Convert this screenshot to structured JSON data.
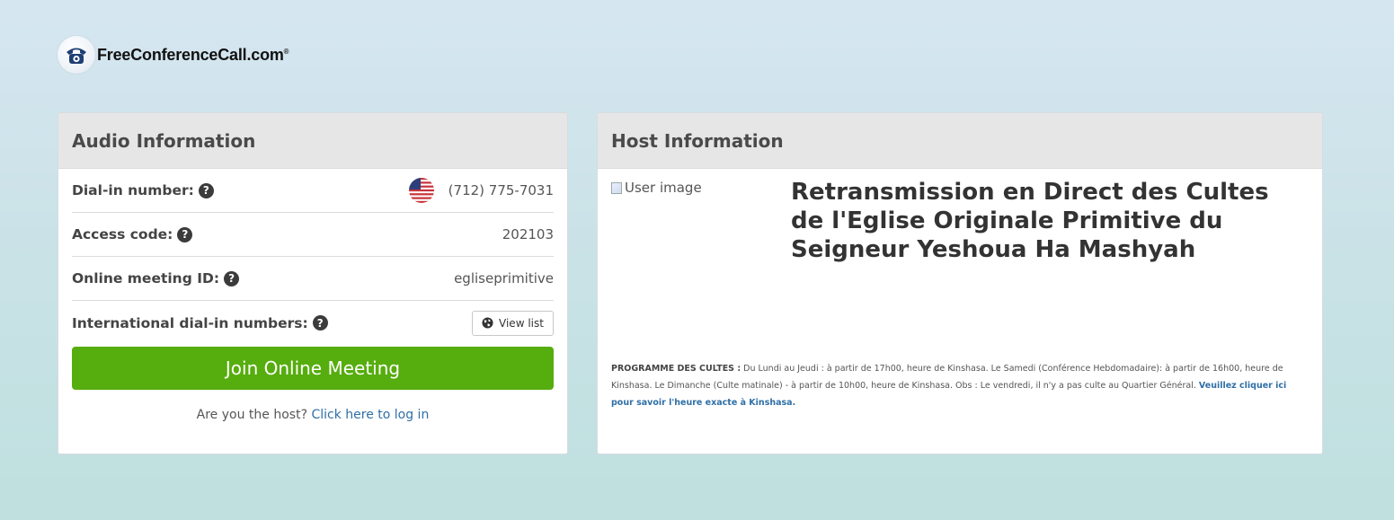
{
  "brand": {
    "name": "FreeConferenceCall.com",
    "reg_mark": "®"
  },
  "audio": {
    "title": "Audio Information",
    "dial_in_label": "Dial-in number:",
    "dial_in_value": "(712) 775-7031",
    "access_code_label": "Access code:",
    "access_code_value": "202103",
    "meeting_id_label": "Online meeting ID:",
    "meeting_id_value": "egliseprimitive",
    "intl_label": "International dial-in numbers:",
    "view_list_label": "View list",
    "join_label": "Join Online Meeting",
    "host_prompt": "Are you the host?",
    "host_login_label": "Click here to log in"
  },
  "host": {
    "title": "Host Information",
    "user_image_alt": "User image",
    "meeting_title": "Retransmission en Direct des Cultes de l'Eglise Originale Primitive du Seigneur Yeshoua Ha Mashyah",
    "programme_label": "PROGRAMME DES CULTES :",
    "programme_text": "Du Lundi au Jeudi : à partir de 17h00, heure de Kinshasa. Le Samedi (Conférence Hebdomadaire): à partir de 16h00, heure de Kinshasa. Le Dimanche (Culte matinale) - à partir de 10h00, heure de Kinshasa. Obs : Le vendredi, il n'y a pas culte au Quartier Général.",
    "programme_link": "Veuillez cliquer ici pour savoir l'heure exacte à Kinshasa."
  },
  "icons": {
    "logo": "phone-logo-icon",
    "help": "question-circle-icon",
    "flag": "us-flag-icon",
    "globe": "globe-icon"
  },
  "colors": {
    "join_button": "#56ad0e",
    "link": "#2f6fa6",
    "header_bg": "#e6e6e6"
  }
}
